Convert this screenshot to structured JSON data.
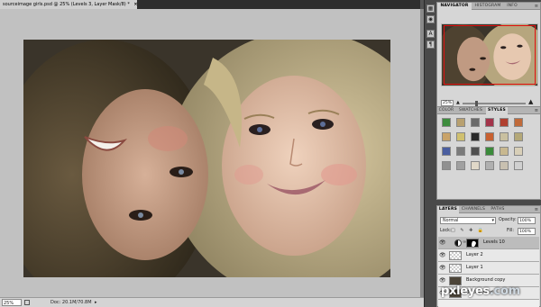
{
  "document": {
    "tab_title": "sourceimage girls.psd @ 25% (Levels 3, Layer Mask/8) *",
    "close_glyph": "×"
  },
  "status_bar": {
    "zoom": "25%",
    "doc_info": "Doc: 20.1M/70.8M",
    "arrow": "▸"
  },
  "navigator_panel": {
    "tabs": [
      "NAVIGATOR",
      "HISTOGRAM",
      "INFO"
    ],
    "active_tab": "NAVIGATOR",
    "zoom": "25%",
    "menu_glyph": "≡"
  },
  "styles_panel": {
    "tabs": [
      "COLOR",
      "SWATCHES",
      "STYLES"
    ],
    "active_tab": "STYLES",
    "menu_glyph": "≡",
    "swatch_colors": [
      "#3d8c3d",
      "#b8a070",
      "#6a6a6a",
      "#a3344a",
      "#b04030",
      "#c06a3a",
      "#c9a36a",
      "#d0c070",
      "#2a2a2a",
      "#c86030",
      "#c9c0a0",
      "#b4a878",
      "#4a5ea0",
      "#7a7a7a",
      "#505050",
      "#3a8a3a",
      "#c8b890",
      "#d8cfb8",
      "#909090",
      "#a0a0a0",
      "#e0d8c8",
      "#b0b0b0",
      "#c8c0b0",
      "#d0d0d0"
    ]
  },
  "layers_panel": {
    "tabs": [
      "LAYERS",
      "CHANNELS",
      "PATHS"
    ],
    "active_tab": "LAYERS",
    "menu_glyph": "≡",
    "blend_mode": "Normal",
    "opacity_label": "Opacity:",
    "opacity_value": "100%",
    "lock_label": "Lock:",
    "lock_icons": "□ ✎ ✚ 🔒",
    "fill_label": "Fill:",
    "fill_value": "100%",
    "layers": [
      {
        "name": "Levels 10",
        "selected": true,
        "type": "adjustment"
      },
      {
        "name": "Layer 2",
        "selected": false,
        "type": "transparent"
      },
      {
        "name": "Layer 1",
        "selected": false,
        "type": "transparent"
      },
      {
        "name": "Background copy",
        "selected": false,
        "type": "photo"
      },
      {
        "name": "Background",
        "selected": false,
        "type": "photo"
      }
    ]
  },
  "dock_icons": [
    "brush-settings-icon",
    "clone-source-icon",
    "character-icon",
    "paragraph-icon"
  ],
  "watermark": {
    "text_a": "pxleyes",
    "text_b": ".com"
  }
}
